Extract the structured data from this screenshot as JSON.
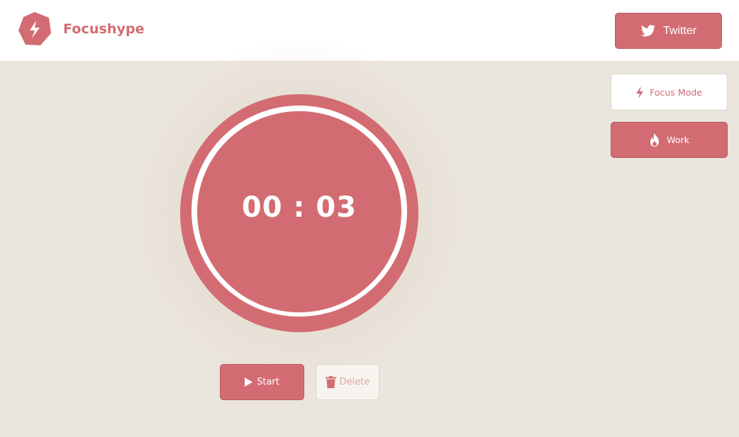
{
  "header": {
    "brand": "Focushype",
    "twitter_label": "Twitter"
  },
  "timer": {
    "display": "00 : 03"
  },
  "controls": {
    "start_label": "Start",
    "delete_label": "Delete"
  },
  "modes": [
    {
      "label": "Focus Mode",
      "icon": "bolt-icon",
      "active": false
    },
    {
      "label": "Work",
      "icon": "flame-icon",
      "active": true
    }
  ],
  "colors": {
    "accent": "#d36c72",
    "background": "#ebe6dd",
    "surface": "#ffffff"
  }
}
